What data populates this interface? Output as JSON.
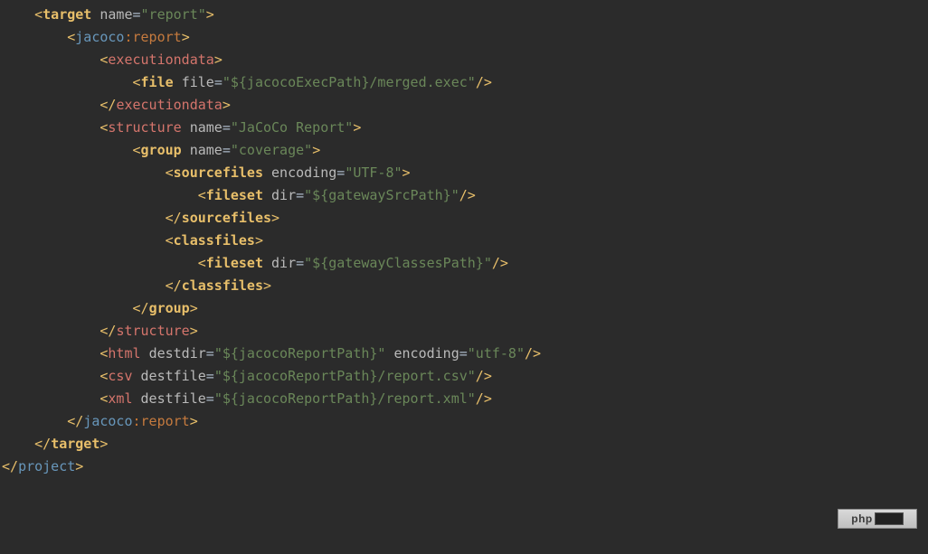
{
  "code": {
    "indent": "    ",
    "lines": [
      {
        "i": 1,
        "open": "<",
        "tag": "target",
        "tagClass": "tag-y",
        "attrs": [
          {
            "n": "name",
            "v": "\"report\""
          }
        ],
        "close": ">"
      },
      {
        "i": 2,
        "open": "<",
        "ns": "jacoco",
        "nsClass": "tag-b",
        "colon": ":",
        "tag": "report",
        "tagClass": "tag-rep",
        "close": ">"
      },
      {
        "i": 3,
        "open": "<",
        "tag": "executiondata",
        "tagClass": "tag-r",
        "close": ">"
      },
      {
        "i": 4,
        "open": "<",
        "tag": "file",
        "tagClass": "tag-y",
        "attrs": [
          {
            "n": "file",
            "v": "\"${jacocoExecPath}/merged.exec\""
          }
        ],
        "close": "/>"
      },
      {
        "i": 3,
        "open": "</",
        "tag": "executiondata",
        "tagClass": "tag-r",
        "close": ">"
      },
      {
        "i": 3,
        "open": "<",
        "tag": "structure",
        "tagClass": "tag-r",
        "attrs": [
          {
            "n": "name",
            "v": "\"JaCoCo Report\""
          }
        ],
        "close": ">"
      },
      {
        "i": 4,
        "open": "<",
        "tag": "group",
        "tagClass": "tag-y",
        "attrs": [
          {
            "n": "name",
            "v": "\"coverage\""
          }
        ],
        "close": ">"
      },
      {
        "i": 5,
        "open": "<",
        "tag": "sourcefiles",
        "tagClass": "tag-y",
        "attrs": [
          {
            "n": "encoding",
            "v": "\"UTF-8\""
          }
        ],
        "close": ">"
      },
      {
        "i": 6,
        "open": "<",
        "tag": "fileset",
        "tagClass": "tag-y",
        "attrs": [
          {
            "n": "dir",
            "v": "\"${gatewaySrcPath}\""
          }
        ],
        "close": "/>"
      },
      {
        "i": 5,
        "open": "</",
        "tag": "sourcefiles",
        "tagClass": "tag-y",
        "close": ">"
      },
      {
        "i": 5,
        "open": "<",
        "tag": "classfiles",
        "tagClass": "tag-y",
        "close": ">"
      },
      {
        "i": 6,
        "open": "<",
        "tag": "fileset",
        "tagClass": "tag-y",
        "attrs": [
          {
            "n": "dir",
            "v": "\"${gatewayClassesPath}\""
          }
        ],
        "close": "/>"
      },
      {
        "i": 5,
        "open": "</",
        "tag": "classfiles",
        "tagClass": "tag-y",
        "close": ">"
      },
      {
        "i": 4,
        "open": "</",
        "tag": "group",
        "tagClass": "tag-y",
        "close": ">"
      },
      {
        "i": 3,
        "open": "</",
        "tag": "structure",
        "tagClass": "tag-r",
        "close": ">"
      },
      {
        "i": 3,
        "open": "<",
        "tag": "html",
        "tagClass": "tag-r",
        "attrs": [
          {
            "n": "destdir",
            "v": "\"${jacocoReportPath}\""
          },
          {
            "n": "encoding",
            "v": "\"utf-8\""
          }
        ],
        "close": "/>"
      },
      {
        "i": 3,
        "open": "<",
        "tag": "csv",
        "tagClass": "tag-r",
        "attrs": [
          {
            "n": "destfile",
            "v": "\"${jacocoReportPath}/report.csv\""
          }
        ],
        "close": "/>"
      },
      {
        "i": 3,
        "open": "<",
        "tag": "xml",
        "tagClass": "tag-r",
        "attrs": [
          {
            "n": "destfile",
            "v": "\"${jacocoReportPath}/report.xml\""
          }
        ],
        "close": "/>"
      },
      {
        "i": 2,
        "open": "</",
        "ns": "jacoco",
        "nsClass": "tag-b",
        "colon": ":",
        "tag": "report",
        "tagClass": "tag-rep",
        "close": ">"
      },
      {
        "i": 1,
        "open": "</",
        "tag": "target",
        "tagClass": "tag-y",
        "close": ">"
      },
      {
        "i": 0,
        "open": "</",
        "tag": "project",
        "tagClass": "tag-b",
        "close": ">"
      }
    ]
  },
  "watermark": {
    "label": "php"
  }
}
